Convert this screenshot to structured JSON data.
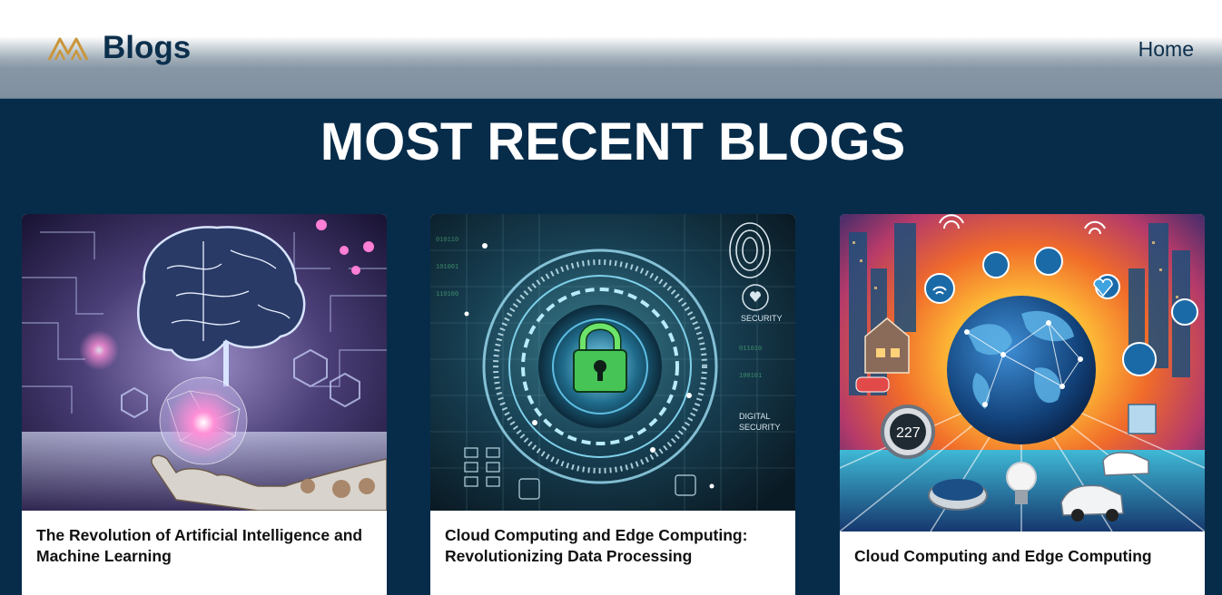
{
  "header": {
    "brand": "Blogs",
    "nav": {
      "home_label": "Home"
    },
    "logo_icon": "mountain-logo-icon",
    "logo_color": "#c9963a"
  },
  "main": {
    "title": "MOST RECENT BLOGS",
    "cards": [
      {
        "title": "The Revolution of Artificial Intelligence and Machine Learning",
        "image_icon": "ai-brain-illustration"
      },
      {
        "title": "Cloud Computing and Edge Computing: Revolutionizing Data Processing",
        "image_icon": "security-lock-illustration"
      },
      {
        "title": "Cloud Computing and Edge Computing",
        "image_icon": "iot-globe-illustration"
      }
    ]
  },
  "colors": {
    "page_background": "#072c4a",
    "brand_text": "#0c2f4c",
    "title_text": "#ffffff"
  }
}
